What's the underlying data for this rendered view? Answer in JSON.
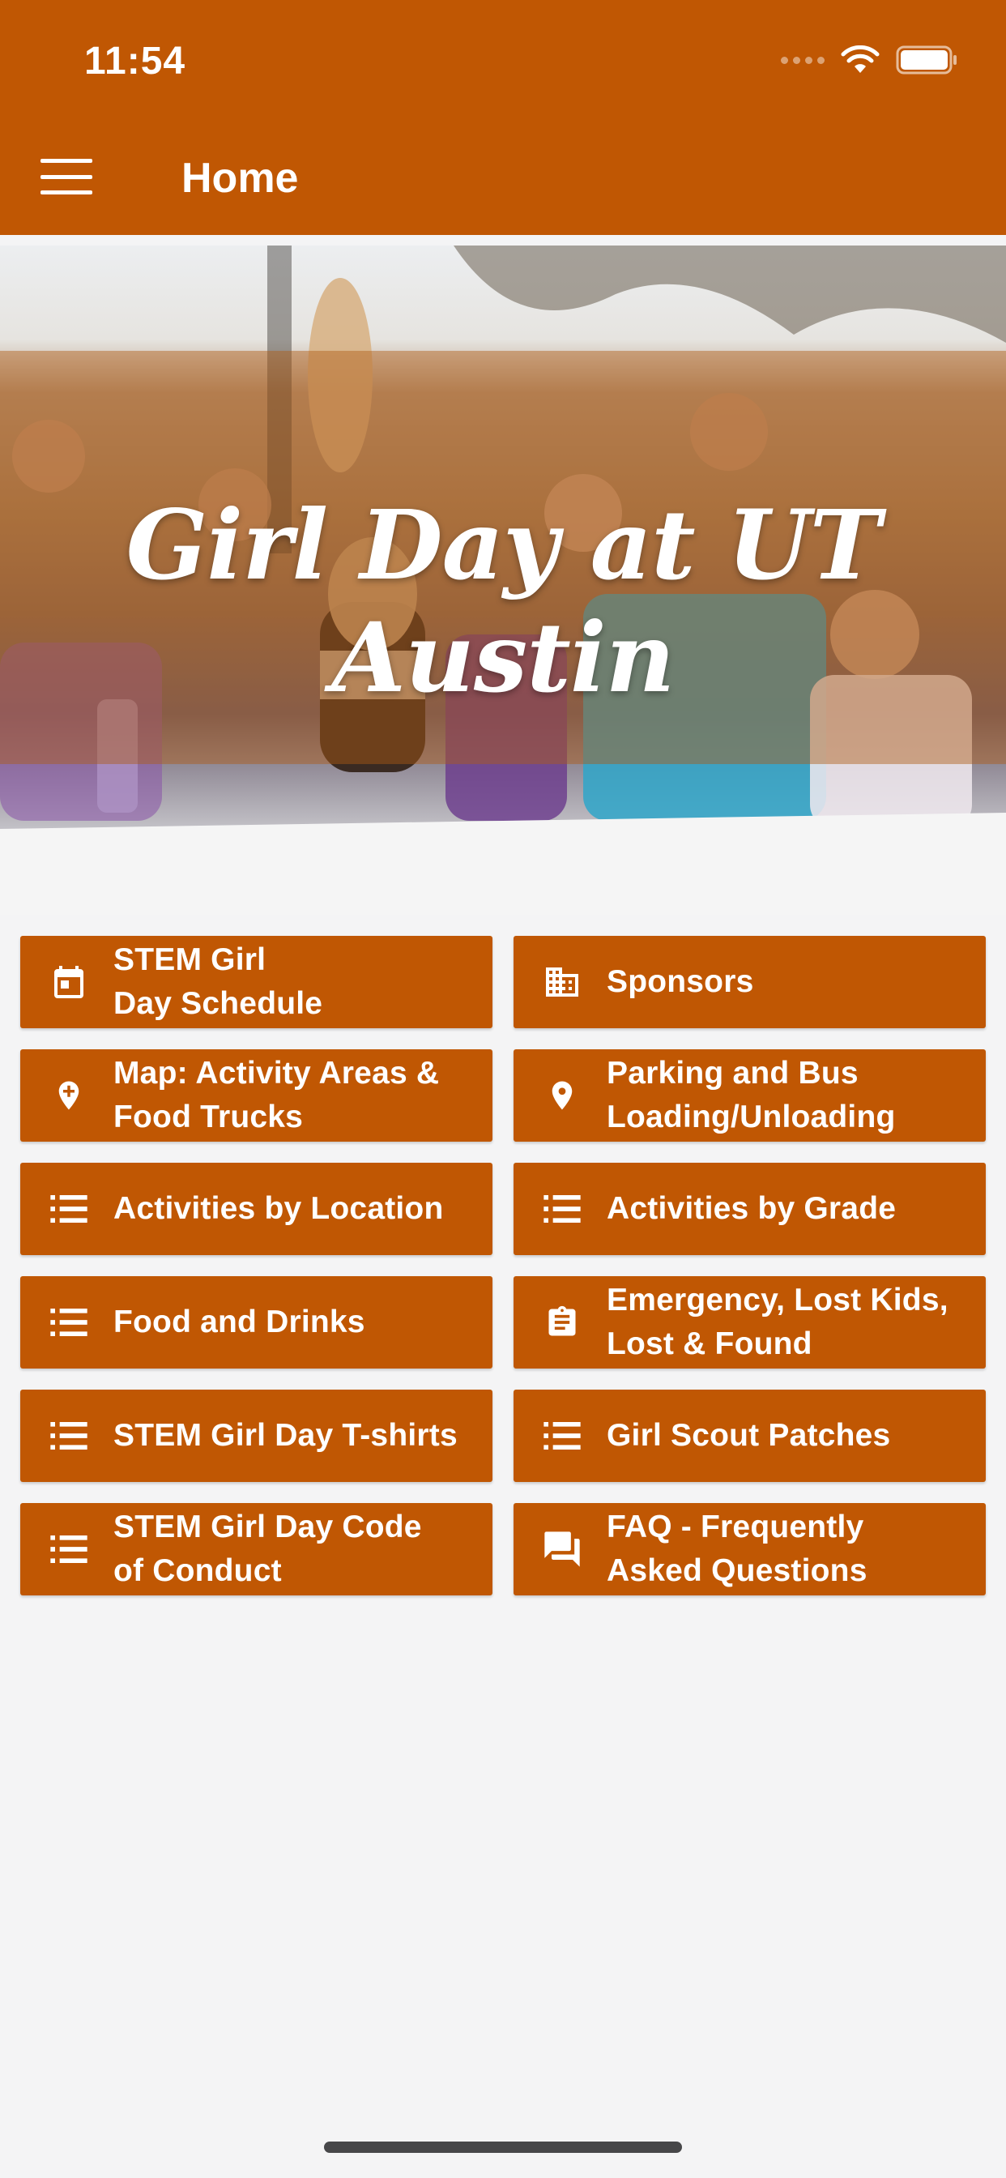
{
  "status_bar": {
    "time": "11:54"
  },
  "header": {
    "title": "Home",
    "menu_icon": "hamburger-menu-icon"
  },
  "banner": {
    "title": "Girl Day at UT Austin"
  },
  "tiles": [
    {
      "label": "STEM Girl\nDay Schedule",
      "icon": "calendar-icon"
    },
    {
      "label": "Sponsors",
      "icon": "building-icon"
    },
    {
      "label": "Map: Activity Areas &\nFood Trucks",
      "icon": "map-pin-plus-icon"
    },
    {
      "label": "Parking and Bus\nLoading/Unloading",
      "icon": "map-pin-icon"
    },
    {
      "label": "Activities by Location",
      "icon": "list-icon"
    },
    {
      "label": "Activities by Grade",
      "icon": "list-icon"
    },
    {
      "label": "Food and Drinks",
      "icon": "list-icon"
    },
    {
      "label": "Emergency, Lost Kids,\nLost & Found",
      "icon": "clipboard-icon"
    },
    {
      "label": "STEM Girl Day T-shirts",
      "icon": "list-icon"
    },
    {
      "label": "Girl Scout Patches",
      "icon": "list-icon"
    },
    {
      "label": "STEM Girl Day Code\nof Conduct",
      "icon": "list-icon"
    },
    {
      "label": "FAQ - Frequently\nAsked Questions",
      "icon": "chat-bubbles-icon"
    }
  ],
  "colors": {
    "primary": "#c05703",
    "background": "#f4f4f5",
    "text_on_primary": "#ffffff"
  }
}
